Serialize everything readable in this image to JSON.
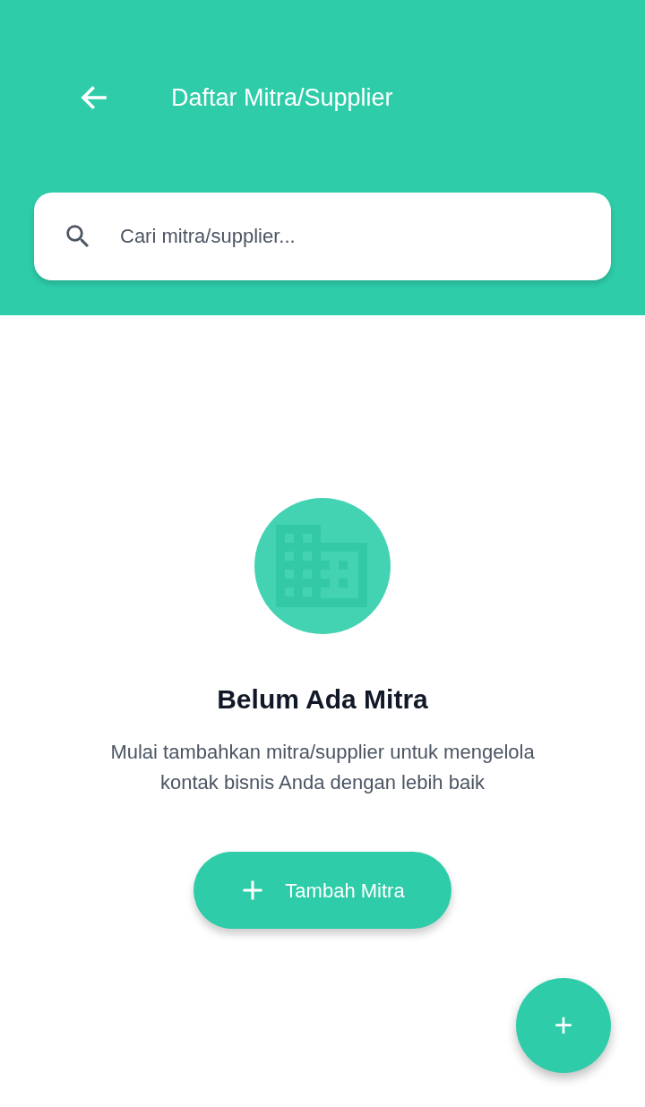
{
  "header": {
    "title": "Daftar Mitra/Supplier"
  },
  "search": {
    "placeholder": "Cari mitra/supplier..."
  },
  "empty_state": {
    "title": "Belum Ada Mitra",
    "message": "Mulai tambahkan mitra/supplier untuk mengelola kontak bisnis Anda dengan lebih baik",
    "button": "Tambah Mitra"
  },
  "fab": {
    "label": "+"
  }
}
